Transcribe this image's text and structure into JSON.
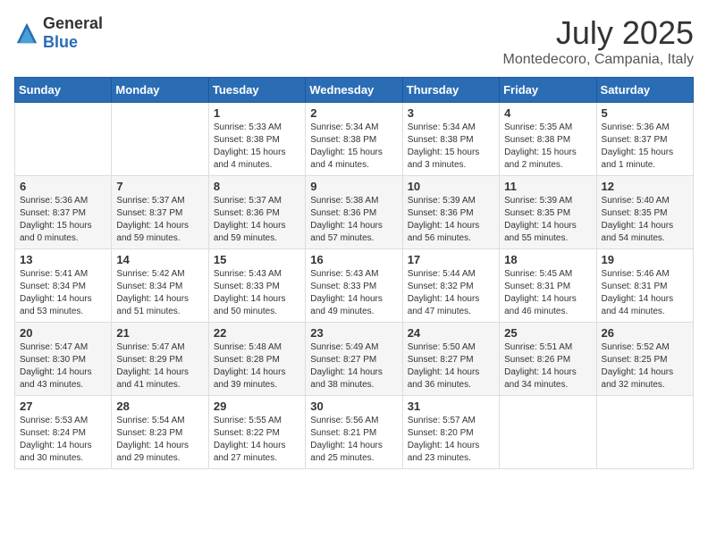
{
  "logo": {
    "text_general": "General",
    "text_blue": "Blue"
  },
  "title": {
    "month_year": "July 2025",
    "location": "Montedecoro, Campania, Italy"
  },
  "days_of_week": [
    "Sunday",
    "Monday",
    "Tuesday",
    "Wednesday",
    "Thursday",
    "Friday",
    "Saturday"
  ],
  "weeks": [
    [
      {
        "day": "",
        "info": ""
      },
      {
        "day": "",
        "info": ""
      },
      {
        "day": "1",
        "info": "Sunrise: 5:33 AM\nSunset: 8:38 PM\nDaylight: 15 hours and 4 minutes."
      },
      {
        "day": "2",
        "info": "Sunrise: 5:34 AM\nSunset: 8:38 PM\nDaylight: 15 hours and 4 minutes."
      },
      {
        "day": "3",
        "info": "Sunrise: 5:34 AM\nSunset: 8:38 PM\nDaylight: 15 hours and 3 minutes."
      },
      {
        "day": "4",
        "info": "Sunrise: 5:35 AM\nSunset: 8:38 PM\nDaylight: 15 hours and 2 minutes."
      },
      {
        "day": "5",
        "info": "Sunrise: 5:36 AM\nSunset: 8:37 PM\nDaylight: 15 hours and 1 minute."
      }
    ],
    [
      {
        "day": "6",
        "info": "Sunrise: 5:36 AM\nSunset: 8:37 PM\nDaylight: 15 hours and 0 minutes."
      },
      {
        "day": "7",
        "info": "Sunrise: 5:37 AM\nSunset: 8:37 PM\nDaylight: 14 hours and 59 minutes."
      },
      {
        "day": "8",
        "info": "Sunrise: 5:37 AM\nSunset: 8:36 PM\nDaylight: 14 hours and 59 minutes."
      },
      {
        "day": "9",
        "info": "Sunrise: 5:38 AM\nSunset: 8:36 PM\nDaylight: 14 hours and 57 minutes."
      },
      {
        "day": "10",
        "info": "Sunrise: 5:39 AM\nSunset: 8:36 PM\nDaylight: 14 hours and 56 minutes."
      },
      {
        "day": "11",
        "info": "Sunrise: 5:39 AM\nSunset: 8:35 PM\nDaylight: 14 hours and 55 minutes."
      },
      {
        "day": "12",
        "info": "Sunrise: 5:40 AM\nSunset: 8:35 PM\nDaylight: 14 hours and 54 minutes."
      }
    ],
    [
      {
        "day": "13",
        "info": "Sunrise: 5:41 AM\nSunset: 8:34 PM\nDaylight: 14 hours and 53 minutes."
      },
      {
        "day": "14",
        "info": "Sunrise: 5:42 AM\nSunset: 8:34 PM\nDaylight: 14 hours and 51 minutes."
      },
      {
        "day": "15",
        "info": "Sunrise: 5:43 AM\nSunset: 8:33 PM\nDaylight: 14 hours and 50 minutes."
      },
      {
        "day": "16",
        "info": "Sunrise: 5:43 AM\nSunset: 8:33 PM\nDaylight: 14 hours and 49 minutes."
      },
      {
        "day": "17",
        "info": "Sunrise: 5:44 AM\nSunset: 8:32 PM\nDaylight: 14 hours and 47 minutes."
      },
      {
        "day": "18",
        "info": "Sunrise: 5:45 AM\nSunset: 8:31 PM\nDaylight: 14 hours and 46 minutes."
      },
      {
        "day": "19",
        "info": "Sunrise: 5:46 AM\nSunset: 8:31 PM\nDaylight: 14 hours and 44 minutes."
      }
    ],
    [
      {
        "day": "20",
        "info": "Sunrise: 5:47 AM\nSunset: 8:30 PM\nDaylight: 14 hours and 43 minutes."
      },
      {
        "day": "21",
        "info": "Sunrise: 5:47 AM\nSunset: 8:29 PM\nDaylight: 14 hours and 41 minutes."
      },
      {
        "day": "22",
        "info": "Sunrise: 5:48 AM\nSunset: 8:28 PM\nDaylight: 14 hours and 39 minutes."
      },
      {
        "day": "23",
        "info": "Sunrise: 5:49 AM\nSunset: 8:27 PM\nDaylight: 14 hours and 38 minutes."
      },
      {
        "day": "24",
        "info": "Sunrise: 5:50 AM\nSunset: 8:27 PM\nDaylight: 14 hours and 36 minutes."
      },
      {
        "day": "25",
        "info": "Sunrise: 5:51 AM\nSunset: 8:26 PM\nDaylight: 14 hours and 34 minutes."
      },
      {
        "day": "26",
        "info": "Sunrise: 5:52 AM\nSunset: 8:25 PM\nDaylight: 14 hours and 32 minutes."
      }
    ],
    [
      {
        "day": "27",
        "info": "Sunrise: 5:53 AM\nSunset: 8:24 PM\nDaylight: 14 hours and 30 minutes."
      },
      {
        "day": "28",
        "info": "Sunrise: 5:54 AM\nSunset: 8:23 PM\nDaylight: 14 hours and 29 minutes."
      },
      {
        "day": "29",
        "info": "Sunrise: 5:55 AM\nSunset: 8:22 PM\nDaylight: 14 hours and 27 minutes."
      },
      {
        "day": "30",
        "info": "Sunrise: 5:56 AM\nSunset: 8:21 PM\nDaylight: 14 hours and 25 minutes."
      },
      {
        "day": "31",
        "info": "Sunrise: 5:57 AM\nSunset: 8:20 PM\nDaylight: 14 hours and 23 minutes."
      },
      {
        "day": "",
        "info": ""
      },
      {
        "day": "",
        "info": ""
      }
    ]
  ]
}
